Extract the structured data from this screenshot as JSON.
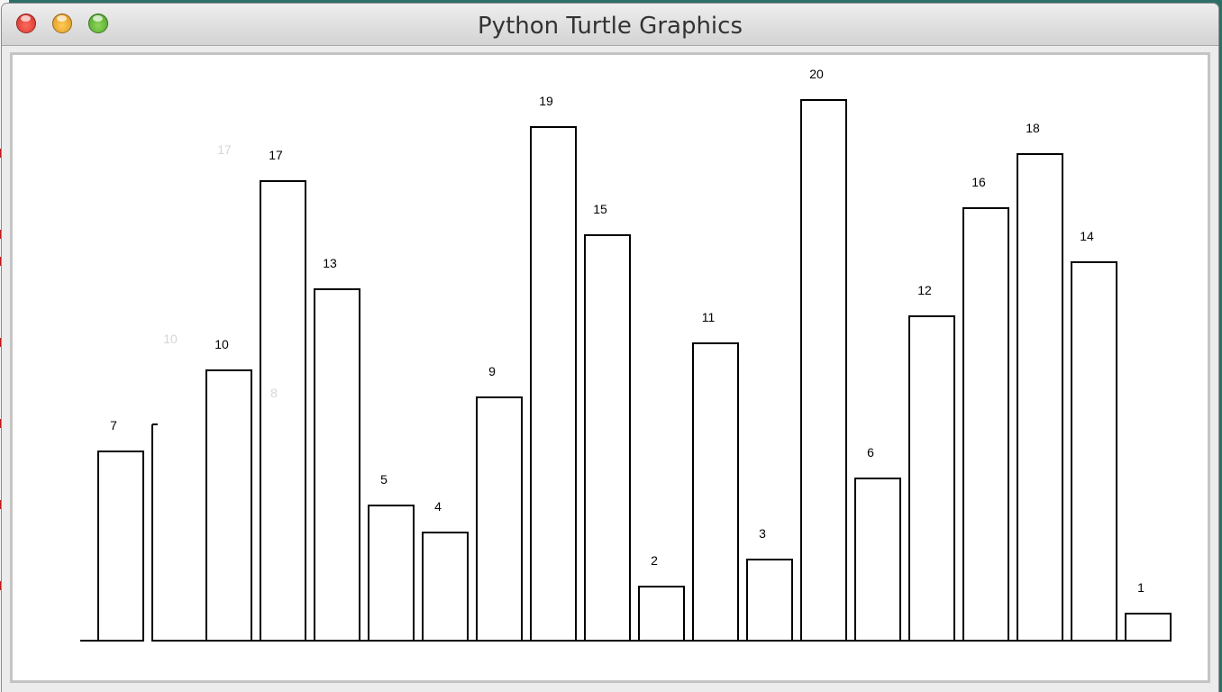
{
  "window": {
    "title": "Python Turtle Graphics"
  },
  "chart_data": {
    "type": "bar",
    "title": "",
    "xlabel": "",
    "ylabel": "",
    "ylim": [
      0,
      20
    ],
    "grid": false,
    "values": [
      7,
      null,
      10,
      17,
      13,
      5,
      4,
      9,
      19,
      15,
      2,
      11,
      3,
      20,
      6,
      12,
      16,
      18,
      14,
      1
    ],
    "labels": [
      "7",
      "",
      "10",
      "17",
      "13",
      "5",
      "4",
      "9",
      "19",
      "15",
      "2",
      "11",
      "3",
      "20",
      "6",
      "12",
      "16",
      "18",
      "14",
      "1"
    ],
    "ghost_labels": [
      "10",
      "17",
      "8"
    ],
    "colors": {
      "bar_stroke": "#000000",
      "bar_fill": "#ffffff",
      "ghost_text": "#d6d6d6"
    }
  }
}
